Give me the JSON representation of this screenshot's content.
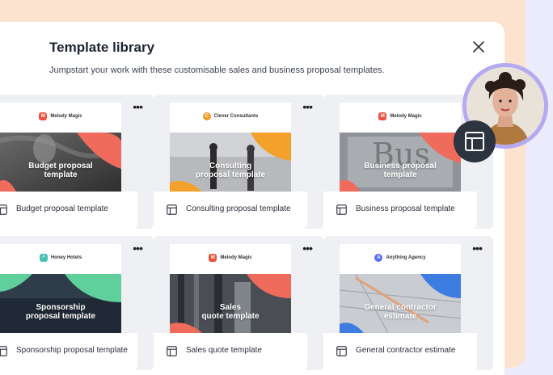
{
  "dialog": {
    "title": "Template library",
    "subtitle": "Jumpstart your work with these customisable sales and business proposal templates."
  },
  "templates": [
    {
      "brand": "Melody Magic",
      "brand_color": "#e8533f",
      "thumb_title": "Budget proposal\ntemplate",
      "label": "Budget proposal template",
      "more": "•••"
    },
    {
      "brand": "Clever Consultants",
      "brand_color": "#f29b2a",
      "thumb_title": "Consulting\nproposal template",
      "label": "Consulting proposal template",
      "more": "•••"
    },
    {
      "brand": "Melody Magic",
      "brand_color": "#e8533f",
      "thumb_title": "Business proposal\ntemplate",
      "label": "Business proposal template",
      "more": "•••"
    },
    {
      "brand": "Honey Hotels",
      "brand_color": "#47c0b1",
      "thumb_title": "Sponsorship\nproposal template",
      "label": "Sponsorship proposal template",
      "more": "•••"
    },
    {
      "brand": "Melody Magic",
      "brand_color": "#e8533f",
      "thumb_title": "Sales\nquote template",
      "label": "Sales quote template",
      "more": "•••"
    },
    {
      "brand": "Anything Agency",
      "brand_color": "#5b6cf0",
      "thumb_title": "General contractor\nestimate",
      "label": "General contractor estimate",
      "more": "•••"
    }
  ],
  "colors": {
    "coral": "#ef6b5b",
    "orange": "#f4a12b",
    "green": "#5fcf9b",
    "blue": "#3d7ce0",
    "pink": "#f07a72"
  },
  "icons": {
    "close": "close-icon",
    "template": "layout-template-icon"
  }
}
